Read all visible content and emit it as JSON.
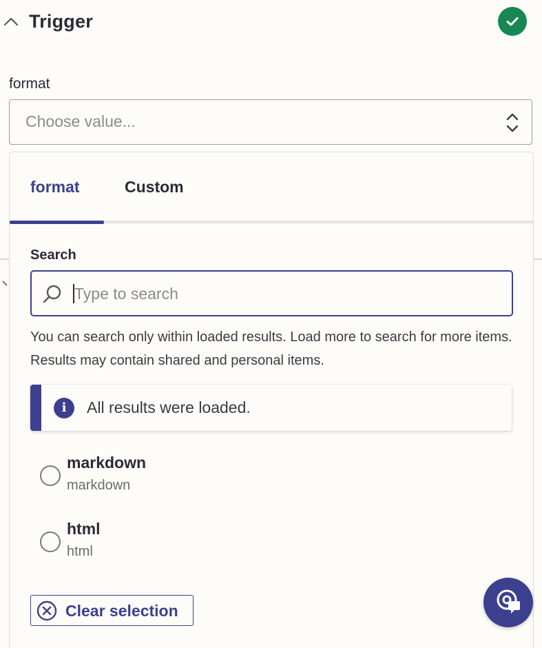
{
  "header": {
    "title": "Trigger",
    "status_icon": "check-circle-icon",
    "status_color": "#198754"
  },
  "field": {
    "label": "format",
    "placeholder": "Choose value..."
  },
  "dropdown": {
    "tabs": [
      {
        "label": "format",
        "active": true
      },
      {
        "label": "Custom",
        "active": false
      }
    ],
    "search": {
      "label": "Search",
      "placeholder": "Type to search",
      "value": ""
    },
    "help_text": "You can search only within loaded results. Load more to search for more items. Results may contain shared and personal items.",
    "info_banner": {
      "icon": "info-icon",
      "message": "All results were loaded."
    },
    "options": [
      {
        "label": "markdown",
        "sublabel": "markdown",
        "selected": false
      },
      {
        "label": "html",
        "sublabel": "html",
        "selected": false
      }
    ],
    "clear_label": "Clear selection"
  },
  "colors": {
    "accent": "#3d3f8f",
    "background": "#fdfcf8",
    "text": "#2b2a35"
  },
  "fab": {
    "icon": "help-chat-icon"
  }
}
